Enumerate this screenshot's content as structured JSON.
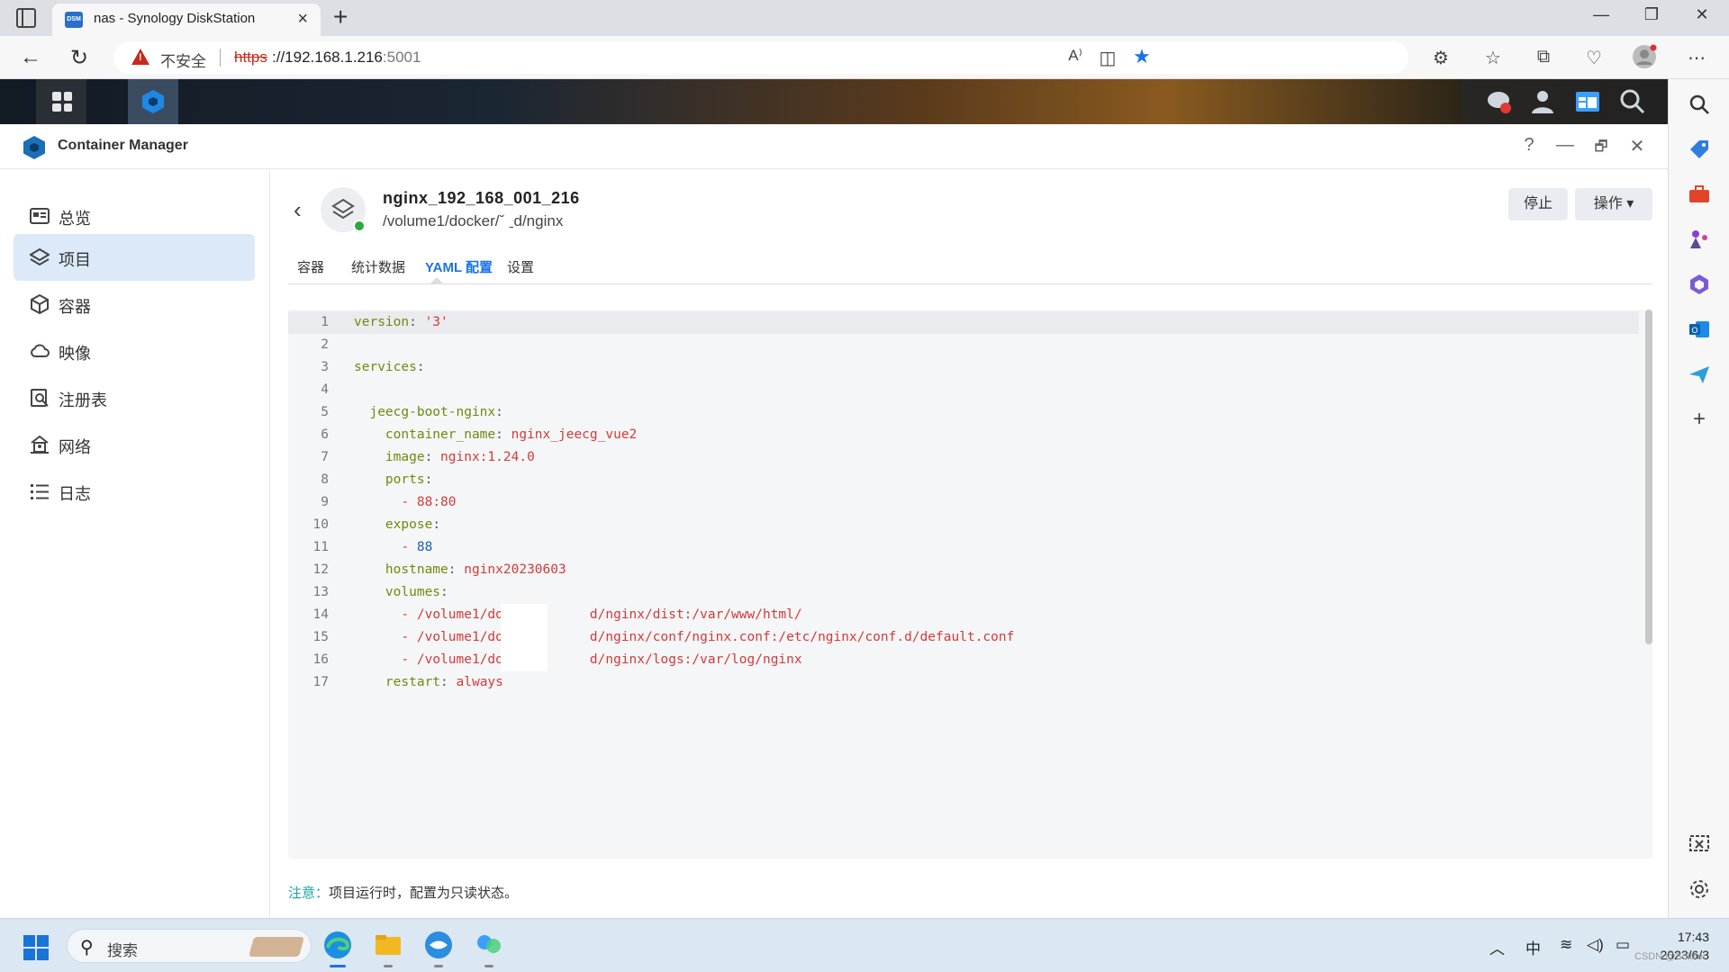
{
  "browser": {
    "tab_title": "nas - Synology DiskStation",
    "tab_favicon_text": "DSM",
    "insecure_label": "不安全",
    "url_scheme": "https",
    "url_host": "://192.168.1.216",
    "url_port": ":5001"
  },
  "app": {
    "name": "Container Manager",
    "help": "?",
    "minimize": "—",
    "restore": "🗗",
    "close": "✕"
  },
  "sidebar": {
    "items": [
      {
        "label": "总览",
        "icon": "overview-icon"
      },
      {
        "label": "项目",
        "icon": "layers-icon",
        "active": true
      },
      {
        "label": "容器",
        "icon": "cube-icon"
      },
      {
        "label": "映像",
        "icon": "cloud-icon"
      },
      {
        "label": "注册表",
        "icon": "registry-search-icon"
      },
      {
        "label": "网络",
        "icon": "network-icon"
      },
      {
        "label": "日志",
        "icon": "list-icon"
      }
    ]
  },
  "project": {
    "name": "nginx_192_168_001_216",
    "path": "/volume1/docker/ˇ   ˍd/nginx",
    "stop_label": "停止",
    "ops_label": "操作 ▾"
  },
  "tabs": [
    "容器",
    "统计数据",
    "YAML 配置",
    "设置"
  ],
  "active_tab": "YAML 配置",
  "yaml": {
    "line_numbers": [
      "1",
      "2",
      "3",
      "4",
      "5",
      "6",
      "7",
      "8",
      "9",
      "10",
      "11",
      "12",
      "13",
      "14",
      "15",
      "16",
      "17"
    ],
    "l1_key": "version",
    "l1_val": "'3'",
    "l3_key": "services",
    "l5_key": "jeecg-boot-nginx",
    "l6_key": "container_name",
    "l6_val": "nginx_jeecg_vue2",
    "l7_key": "image",
    "l7_val": "nginx:1.24.0",
    "l8_key": "ports",
    "l9_val": "88:80",
    "l10_key": "expose",
    "l11_val": "88",
    "l12_key": "hostname",
    "l12_val": "nginx20230603",
    "l13_key": "volumes",
    "l14_val": "/volume1/docker/      d/nginx/dist:/var/www/html/",
    "l15_val": "/volume1/docker/      d/nginx/conf/nginx.conf:/etc/nginx/conf.d/default.conf",
    "l16_val": "/volume1/docker/      d/nginx/logs:/var/log/nginx",
    "l17_key": "restart",
    "l17_val": "always"
  },
  "note": {
    "label": "注意：",
    "text": "项目运行时，配置为只读状态。"
  },
  "taskbar": {
    "search_placeholder": "搜索",
    "ime": "中",
    "time": "17:43",
    "date": "2023/6/3"
  },
  "watermark": "CSDN @Soldier",
  "colors": {
    "accent": "#1a73e8",
    "yaml_key": "#6e8a0d",
    "yaml_string": "#d33a3a",
    "yaml_number": "#1a5fb4",
    "status_running": "#2eaa3c"
  }
}
